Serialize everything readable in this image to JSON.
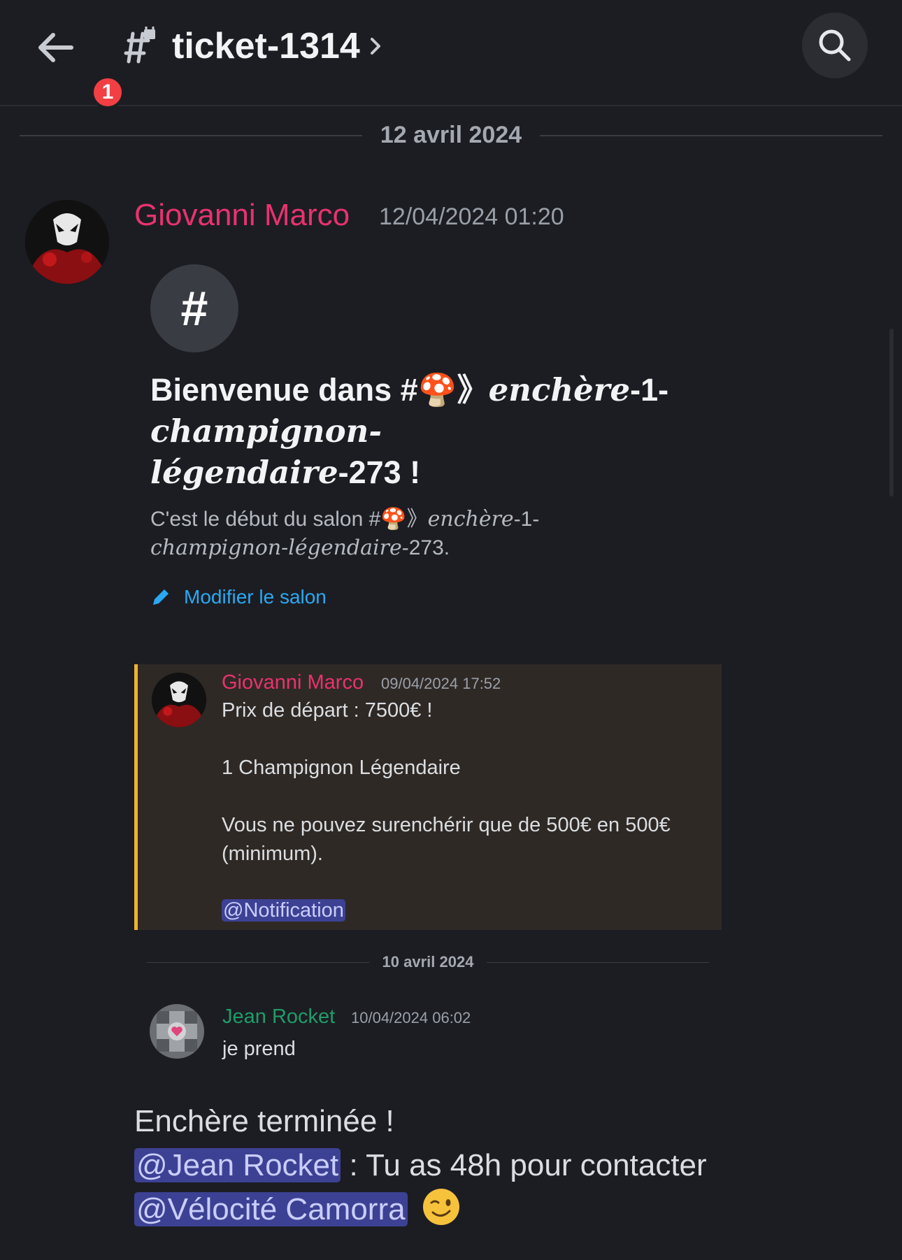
{
  "header": {
    "back_badge": "1",
    "channel_name": "ticket-1314"
  },
  "date_divider_main": "12 avril 2024",
  "message": {
    "author": "Giovanni Marco",
    "author_color": "#e9326e",
    "timestamp": "12/04/2024 01:20",
    "intro": {
      "hash_glyph": "#",
      "welcome_prefix": "Bienvenue dans #🍄》",
      "welcome_fancy_1": "enchère",
      "welcome_mid_1": "-1-",
      "welcome_fancy_2": "champignon-",
      "welcome_fancy_3": "légendaire",
      "welcome_suffix": "-273 !",
      "sub_prefix": "C'est le début du salon #🍄》",
      "sub_fancy_1": "enchère",
      "sub_mid": "-1-",
      "sub_fancy_2": "champignon-légendaire",
      "sub_suffix": "-273.",
      "edit_label": "Modifier le salon"
    },
    "quote": {
      "author": "Giovanni Marco",
      "timestamp": "09/04/2024 17:52",
      "line1": "Prix de départ : 7500€ !",
      "line2": "1 Champignon Légendaire",
      "line3a": "Vous ne pouvez surenchérir que de 500€ en 500€",
      "line3b": "(minimum).",
      "mention": "@Notification",
      "accent_color": "#f0b232"
    },
    "quote_date_divider": "10 avril 2024",
    "reply": {
      "author": "Jean Rocket",
      "author_color": "#1f9d67",
      "timestamp": "10/04/2024 06:02",
      "text": "je prend"
    },
    "ended": {
      "line1": "Enchère terminée !",
      "mention1": "@Jean Rocket",
      "text_mid": " : Tu as 48h pour contacter",
      "mention2": "@Vélocité Camorra"
    }
  }
}
